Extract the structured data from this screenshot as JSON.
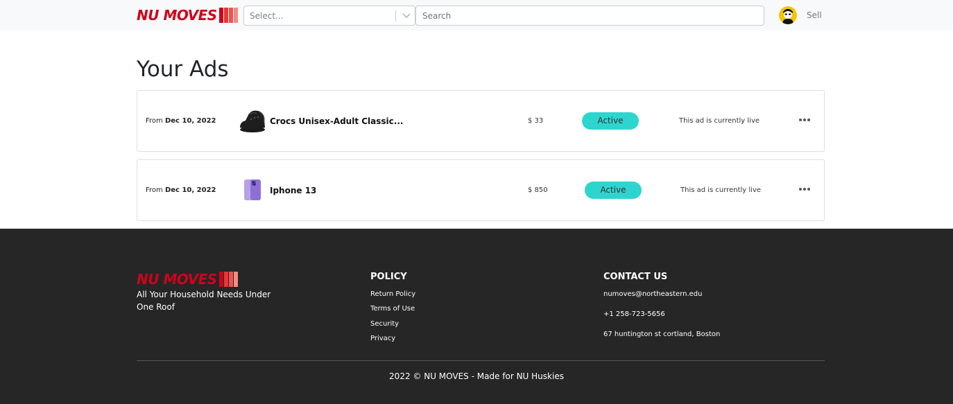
{
  "header": {
    "logo_text": "NU MOVES",
    "select_placeholder": "Select...",
    "search_placeholder": "Search",
    "sell_label": "Sell"
  },
  "main": {
    "title": "Your Ads",
    "ads": [
      {
        "from_label": "From",
        "date": "Dec 10, 2022",
        "name": "Crocs Unisex-Adult Classic...",
        "price": "$ 33",
        "status": "Active",
        "status_note": "This ad is currently live",
        "thumbnail_icon": "clog-shoe-icon"
      },
      {
        "from_label": "From",
        "date": "Dec 10, 2022",
        "name": "Iphone 13",
        "price": "$ 850",
        "status": "Active",
        "status_note": "This ad is currently live",
        "thumbnail_icon": "smartphone-icon"
      }
    ]
  },
  "footer": {
    "logo_text": "NU MOVES",
    "tagline": "All Your Household Needs Under One Roof",
    "policy": {
      "title": "POLICY",
      "links": [
        "Return Policy",
        "Terms of Use",
        "Security",
        "Privacy"
      ]
    },
    "contact": {
      "title": "CONTACT US",
      "items": [
        "numoves@northeastern.edu",
        "+1 258-723-5656",
        "67 huntington st cortland, Boston"
      ]
    },
    "copyright": "2022 © NU MOVES - Made for NU Huskies"
  },
  "colors": {
    "brand_red": "#d0021b",
    "status_teal": "#2ed5cf",
    "footer_bg": "#262626",
    "header_bg": "#f8f9fa"
  }
}
